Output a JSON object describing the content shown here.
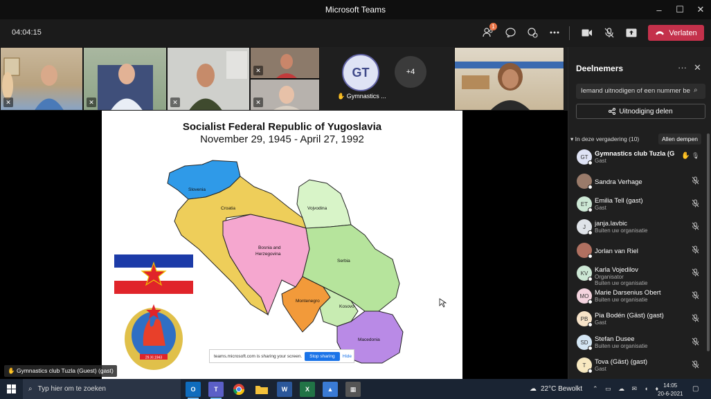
{
  "window": {
    "title": "Microsoft Teams",
    "controls": [
      "–",
      "☐",
      "✕"
    ]
  },
  "meeting": {
    "timer": "04:04:15",
    "participants_badge": "1",
    "leave_label": "Verlaten"
  },
  "gallery": {
    "gt_initials": "GT",
    "gt_label": "Gymnastics ...",
    "overflow_count": "+4"
  },
  "slide": {
    "title": "Socialist Federal Republic of Yugoslavia",
    "subtitle": "November 29, 1945 - April 27, 1992",
    "regions": {
      "slovenia": "Slovenia",
      "croatia": "Croatia",
      "vojvodina": "Vojvodina",
      "bosnia": "Bosnia and",
      "bosnia2": "Herzegovina",
      "serbia": "Serbia",
      "montenegro": "Montenegro",
      "kosovo": "Kosovo",
      "macedonia": "Macedonia"
    },
    "emblem_year": "29.XI.1943"
  },
  "share_bar": {
    "text": "teams.microsoft.com is sharing your screen.",
    "stop_label": "Stop sharing",
    "hide_label": "Hide"
  },
  "caption": "Gymnastics club Tuzla (Guest) (gast)",
  "panel": {
    "title": "Deelnemers",
    "invite_placeholder": "Iemand uitnodigen of een nummer be",
    "share_invite_label": "Uitnodiging delen",
    "section_label": "In deze vergadering (10)",
    "mute_all_label": "Allen dempen",
    "participants": [
      {
        "initials": "GT",
        "name": "Gymnastics club Tuzla (G...",
        "role": "Gast",
        "role2": "",
        "color": "#dfe3f5",
        "bold": true
      },
      {
        "initials": "",
        "name": "Sandra Verhage",
        "role": "",
        "role2": "",
        "color": "#9a7b6a",
        "bold": false
      },
      {
        "initials": "ET",
        "name": "Emilia Tell (gast)",
        "role": "Gast",
        "role2": "",
        "color": "#cde8d5",
        "bold": false
      },
      {
        "initials": "J",
        "name": "janja.lavbic",
        "role": "Buiten uw organisatie",
        "role2": "",
        "color": "#dfe3e8",
        "bold": false
      },
      {
        "initials": "",
        "name": "Jorlan van Riel",
        "role": "",
        "role2": "",
        "color": "#b07060",
        "bold": false
      },
      {
        "initials": "KV",
        "name": "Karla Vojedilov",
        "role": "Organisator",
        "role2": "Buiten uw organisatie",
        "color": "#cde8d5",
        "bold": false
      },
      {
        "initials": "MO",
        "name": "Marie Darsenius Obert",
        "role": "Buiten uw organisatie",
        "role2": "",
        "color": "#f4d4df",
        "bold": false
      },
      {
        "initials": "PB",
        "name": "Pia Bodén (Gäst) (gast)",
        "role": "Gast",
        "role2": "",
        "color": "#f7e3c8",
        "bold": false
      },
      {
        "initials": "SD",
        "name": "Stefan Dusee",
        "role": "Buiten uw organisatie",
        "role2": "",
        "color": "#d4e6f4",
        "bold": false
      },
      {
        "initials": "T",
        "name": "Tova (Gäst) (gast)",
        "role": "Gast",
        "role2": "",
        "color": "#f7e8c0",
        "bold": false
      }
    ]
  },
  "taskbar": {
    "search_placeholder": "Typ hier om te zoeken",
    "weather": "22°C  Bewolkt",
    "time": "14:05",
    "date": "20-6-2021"
  }
}
